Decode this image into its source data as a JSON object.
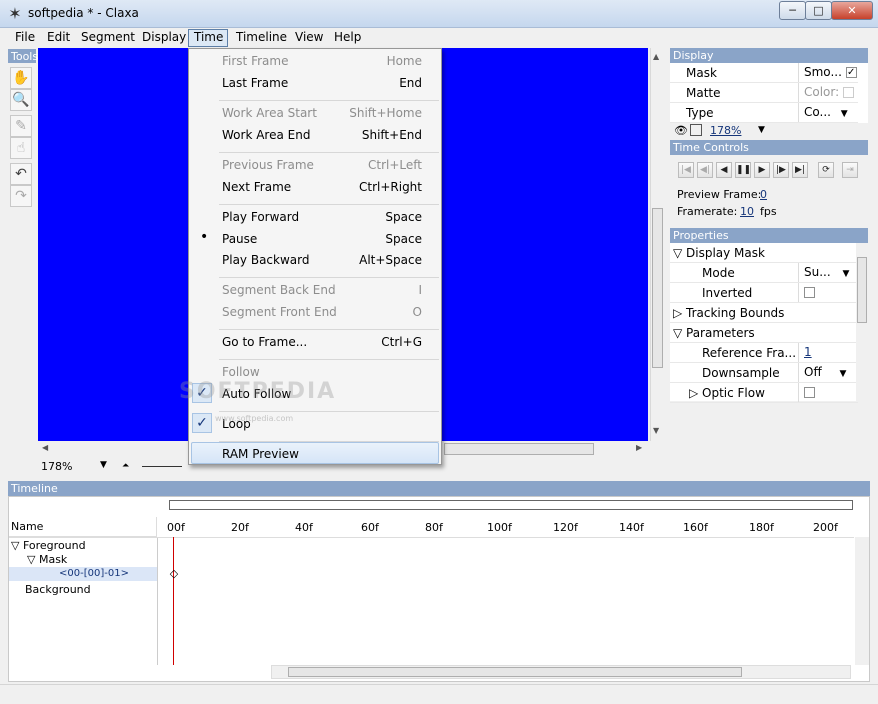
{
  "window": {
    "title": "softpedia * - Claxa",
    "minimize": "─",
    "maximize": "□",
    "close": "✕"
  },
  "menubar": [
    "File",
    "Edit",
    "Segment",
    "Display",
    "Time",
    "Timeline",
    "View",
    "Help"
  ],
  "tools": {
    "title": "Tools"
  },
  "viewer": {
    "zoom": "178%"
  },
  "time_menu": {
    "items": [
      {
        "label": "First Frame",
        "shortcut": "Home",
        "disabled": true
      },
      {
        "label": "Last Frame",
        "shortcut": "End",
        "disabled": false
      },
      {
        "label": "Work Area Start",
        "shortcut": "Shift+Home",
        "disabled": true
      },
      {
        "label": "Work Area End",
        "shortcut": "Shift+End",
        "disabled": false
      },
      {
        "label": "Previous Frame",
        "shortcut": "Ctrl+Left",
        "disabled": true
      },
      {
        "label": "Next Frame",
        "shortcut": "Ctrl+Right",
        "disabled": false
      },
      {
        "label": "Play Forward",
        "shortcut": "Space",
        "disabled": false
      },
      {
        "label": "Pause",
        "shortcut": "Space",
        "disabled": false,
        "bullet": "•"
      },
      {
        "label": "Play Backward",
        "shortcut": "Alt+Space",
        "disabled": false
      },
      {
        "label": "Segment Back End",
        "shortcut": "I",
        "disabled": true
      },
      {
        "label": "Segment Front End",
        "shortcut": "O",
        "disabled": true
      },
      {
        "label": "Go to Frame...",
        "shortcut": "Ctrl+G",
        "disabled": false
      },
      {
        "label": "Follow",
        "shortcut": "",
        "disabled": true
      },
      {
        "label": "Auto Follow",
        "shortcut": "",
        "disabled": false,
        "checked": true
      },
      {
        "label": "Loop",
        "shortcut": "",
        "disabled": false,
        "checked": true
      },
      {
        "label": "RAM Preview",
        "shortcut": "",
        "disabled": false
      }
    ],
    "check_glyph": "✓"
  },
  "display_panel": {
    "title": "Display",
    "rows": [
      {
        "key": "Mask",
        "value": "Smo..."
      },
      {
        "key": "Matte",
        "value": "Color:"
      },
      {
        "key": "Type",
        "value": "Co..."
      }
    ],
    "zoom": "178%"
  },
  "time_controls": {
    "title": "Time Controls",
    "preview_frame_label": "Preview Frame:",
    "preview_frame_value": "0",
    "framerate_label": "Framerate:",
    "framerate_value": "10",
    "framerate_unit": "fps"
  },
  "properties": {
    "title": "Properties",
    "rows": [
      {
        "key": "Display Mask",
        "value": "",
        "indent": 0,
        "expander": "▽"
      },
      {
        "key": "Mode",
        "value": "Su...",
        "indent": 2,
        "expander": ""
      },
      {
        "key": "Inverted",
        "value": "",
        "indent": 2,
        "expander": ""
      },
      {
        "key": "Tracking Bounds",
        "value": "",
        "indent": 0,
        "expander": "▷"
      },
      {
        "key": "Parameters",
        "value": "",
        "indent": 0,
        "expander": "▽"
      },
      {
        "key": "Reference Fra...",
        "value": "1",
        "indent": 2,
        "expander": ""
      },
      {
        "key": "Downsample",
        "value": "Off",
        "indent": 2,
        "expander": ""
      },
      {
        "key": "Optic Flow",
        "value": "",
        "indent": 1,
        "expander": "▷"
      }
    ]
  },
  "timeline": {
    "title": "Timeline",
    "name_header": "Name",
    "ticks": [
      "00f",
      "20f",
      "40f",
      "60f",
      "80f",
      "100f",
      "120f",
      "140f",
      "160f",
      "180f",
      "200f"
    ],
    "layers": [
      {
        "label": "Foreground",
        "indent": 0,
        "expander": "▽"
      },
      {
        "label": "Mask",
        "indent": 1,
        "expander": "▽"
      },
      {
        "label": "<00-[00]-01>",
        "indent": 2,
        "expander": ""
      },
      {
        "label": "Background",
        "indent": 0,
        "expander": ""
      }
    ]
  },
  "watermark": "SOFTPEDIA",
  "watermark_sub": "www.softpedia.com"
}
